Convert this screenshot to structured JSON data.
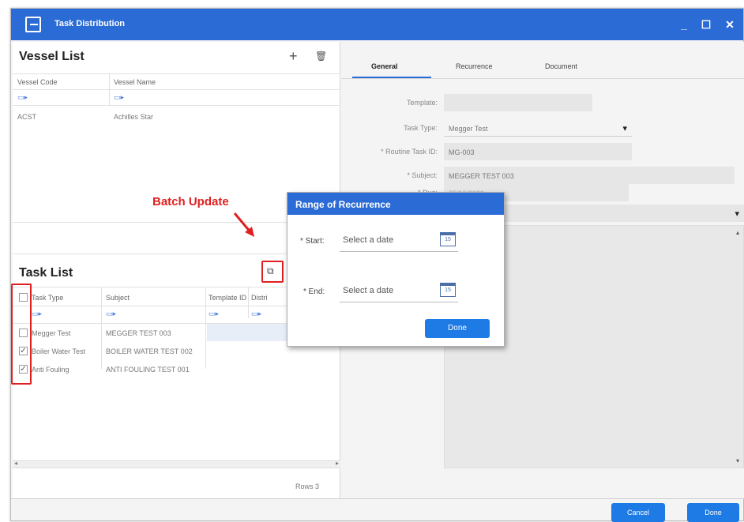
{
  "window": {
    "title": "Task Distribution",
    "minimize_glyph": "_",
    "maximize_glyph": "☐",
    "close_glyph": "✕"
  },
  "vessel_list": {
    "title": "Vessel List",
    "add_glyph": "+",
    "delete_glyph": "🗑",
    "columns": [
      "Vessel Code",
      "Vessel Name"
    ],
    "filter_glyph": "▭▸",
    "rows": [
      {
        "code": "ACST",
        "name": "Achilles Star"
      }
    ]
  },
  "annotation": {
    "batch_update": "Batch Update",
    "color": "#e02020"
  },
  "task_list": {
    "title": "Task List",
    "copy_glyph": "⧉",
    "columns": [
      "Task Type",
      "Subject",
      "Template ID",
      "Distri"
    ],
    "filter_glyph": "▭▸",
    "rows": [
      {
        "checked": false,
        "type": "Megger Test",
        "subject": "MEGGER TEST 003"
      },
      {
        "checked": true,
        "type": "Boiler Water Test",
        "subject": "BOILER WATER TEST 002"
      },
      {
        "checked": true,
        "type": "Anti Fouling",
        "subject": "ANTI FOULING TEST 001"
      }
    ],
    "check_glyph": "✓",
    "scroll_left": "◂",
    "scroll_right": "▸",
    "rows_count": "Rows 3"
  },
  "detail": {
    "tabs": [
      "General",
      "Recurrence",
      "Document"
    ],
    "fields": {
      "template_label": "Template:",
      "template_value": "",
      "task_type_label": "Task Type:",
      "task_type_value": "Megger Test",
      "routine_label": "* Routine Task ID:",
      "routine_value": "MG-003",
      "subject_label": "* Subject:",
      "subject_value": "MEGGER TEST 003",
      "due_label": "* Due:",
      "due_value": "05/10/2022",
      "dropdown_glyph": "▾"
    }
  },
  "dialog": {
    "title": "Range of Recurrence",
    "start_label": "* Start:",
    "start_placeholder": "Select a date",
    "end_label": "* End:",
    "end_placeholder": "Select a date",
    "calendar_number": "15",
    "done_label": "Done"
  },
  "footer": {
    "cancel_label": "Cancel",
    "done_label": "Done"
  },
  "colors": {
    "accent": "#2b6bd6",
    "button": "#1e7be6",
    "annotation": "#e02020"
  }
}
